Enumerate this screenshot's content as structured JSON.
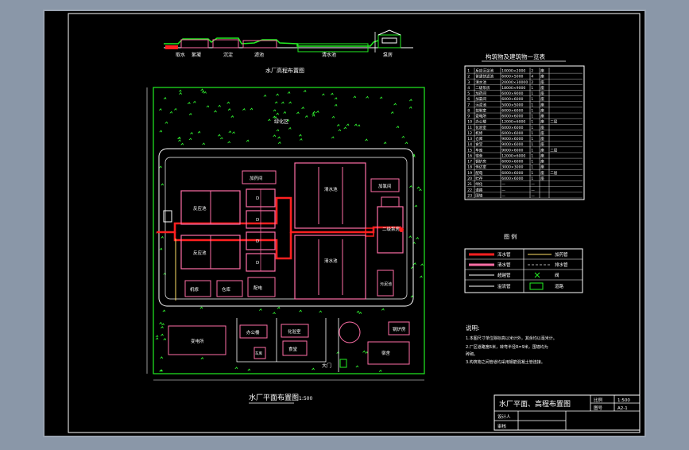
{
  "colors": {
    "viewport_bg": "#8a97a8",
    "sheet": "#000000",
    "line": "#ffffff",
    "site_boundary": "#22ee22",
    "buildings": "#ff6ea6",
    "pipes": "#ff2020",
    "trees": "#33ff33"
  },
  "profile": {
    "caption": "水厂高程布置图",
    "labels": [
      "取水",
      "絮凝",
      "沉淀",
      "滤池",
      "清水池",
      "泵房"
    ]
  },
  "plan": {
    "title": "水厂平面布置图",
    "subtitle": "1:500",
    "greenbelt_label": "绿化区",
    "gate_label": "大门",
    "structures": {
      "dosing": "加药间",
      "chlorination": "加氯间",
      "floc_1": "反应池",
      "floc_2": "反应池",
      "filter_1": "D",
      "filter_2": "D",
      "filter_3": "D",
      "filter_4": "D",
      "clearwell_1": "清水池",
      "clearwell_2": "清水池",
      "pump_house": "二级泵房",
      "sludge": "污泥池",
      "control": "控制室",
      "bottom_left_1": "机修",
      "bottom_left_2": "仓库",
      "bottom_left_3": "配电",
      "substation": "变电所",
      "office": "办公楼",
      "lab": "化验室",
      "canteen": "食堂",
      "garage": "车库",
      "dormitory": "宿舍",
      "boiler": "锅炉房",
      "storage": "贮存"
    }
  },
  "table": {
    "title": "构筑物及建筑物一览表",
    "rows": [
      [
        "1",
        "反应沉淀池",
        "10000×2000",
        "2",
        "座",
        ""
      ],
      [
        "2",
        "普通快滤池",
        "6000×5000",
        "4",
        "座",
        ""
      ],
      [
        "3",
        "清水池",
        "20000×30000",
        "2",
        "座",
        ""
      ],
      [
        "4",
        "二级泵房",
        "18000×9000",
        "1",
        "座",
        ""
      ],
      [
        "5",
        "加药间",
        "6000×9000",
        "1",
        "座",
        ""
      ],
      [
        "6",
        "加氯间",
        "6000×6000",
        "1",
        "座",
        ""
      ],
      [
        "7",
        "污泥池",
        "5000×5000",
        "1",
        "座",
        ""
      ],
      [
        "8",
        "控制室",
        "6000×6000",
        "1",
        "座",
        ""
      ],
      [
        "9",
        "变电所",
        "6000×6000",
        "1",
        "座",
        ""
      ],
      [
        "10",
        "办公楼",
        "12000×6000",
        "1",
        "座",
        "二层"
      ],
      [
        "11",
        "化验室",
        "6000×6000",
        "1",
        "座",
        ""
      ],
      [
        "12",
        "机修",
        "6000×6000",
        "1",
        "座",
        ""
      ],
      [
        "13",
        "仓库",
        "9000×6000",
        "1",
        "座",
        ""
      ],
      [
        "14",
        "食堂",
        "9000×6000",
        "1",
        "座",
        ""
      ],
      [
        "15",
        "车库",
        "9000×6000",
        "1",
        "座",
        "二层"
      ],
      [
        "16",
        "宿舍",
        "12000×6000",
        "1",
        "座",
        ""
      ],
      [
        "17",
        "锅炉房",
        "6000×6000",
        "1",
        "座",
        ""
      ],
      [
        "18",
        "传达室",
        "3000×3000",
        "1",
        "座",
        ""
      ],
      [
        "19",
        "配电",
        "6000×6000",
        "1",
        "座",
        "二层"
      ],
      [
        "20",
        "贮存",
        "6000×6000",
        "1",
        "座",
        ""
      ],
      [
        "21",
        "绿化",
        "—",
        "—",
        "",
        ""
      ],
      [
        "22",
        "道路",
        "—",
        "—",
        "",
        ""
      ],
      [
        "23",
        "围墙",
        "—",
        "—",
        "",
        ""
      ]
    ]
  },
  "legend": {
    "title": "图 例",
    "items": [
      [
        "浑水管",
        "加药管"
      ],
      [
        "清水管",
        "排水管"
      ],
      [
        "超越管",
        "阀"
      ],
      [
        "溢流管",
        "道路"
      ]
    ]
  },
  "notes": {
    "title": "说明:",
    "lines": [
      "1.本图尺寸单位除标高以米计外，其余均以毫米计。",
      "2.厂区道路宽6米，转弯半径R=9米，围墙均为",
      "   砖砌。",
      "3.构筑物之间管道均采用钢筋混凝土管连接。"
    ]
  },
  "title_block": {
    "drawing_title": "水厂平面、高程布置图",
    "ratio_label": "比例",
    "ratio_value": "1:500",
    "sheet_label": "图号",
    "sheet_value": "A2-1",
    "row1_label": "设计人",
    "row2_label": "审核"
  }
}
